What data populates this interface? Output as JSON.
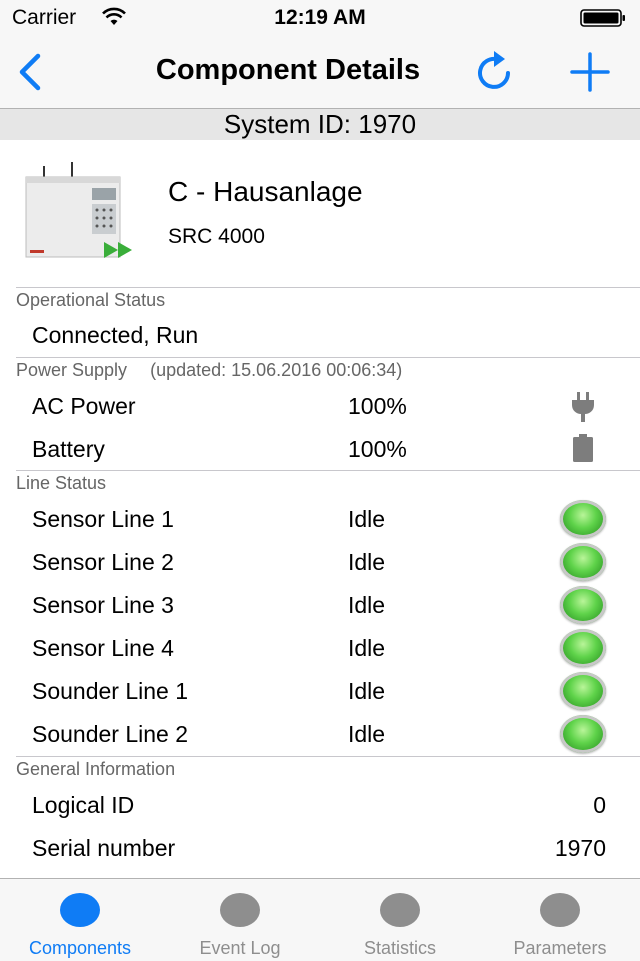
{
  "status_bar": {
    "carrier": "Carrier",
    "time": "12:19 AM"
  },
  "nav": {
    "title": "Component Details",
    "back_icon": "chevron-left-icon",
    "refresh_icon": "refresh-icon",
    "add_icon": "plus-icon"
  },
  "system": {
    "id_text": "System ID: 1970"
  },
  "component": {
    "name": "C -  Hausanlage",
    "model": "SRC 4000"
  },
  "operational": {
    "header": "Operational Status",
    "value": "Connected, Run"
  },
  "power": {
    "header": "Power Supply",
    "updated": "(updated: 15.06.2016 00:06:34)",
    "rows": [
      {
        "label": "AC Power",
        "value": "100%",
        "icon": "plug-icon"
      },
      {
        "label": "Battery",
        "value": "100%",
        "icon": "battery-icon"
      }
    ]
  },
  "lines": {
    "header": "Line Status",
    "rows": [
      {
        "label": "Sensor Line 1",
        "value": "Idle",
        "status_color": "#5fd34a"
      },
      {
        "label": "Sensor Line 2",
        "value": "Idle",
        "status_color": "#5fd34a"
      },
      {
        "label": "Sensor Line 3",
        "value": "Idle",
        "status_color": "#5fd34a"
      },
      {
        "label": "Sensor Line 4",
        "value": "Idle",
        "status_color": "#5fd34a"
      },
      {
        "label": "Sounder Line 1",
        "value": "Idle",
        "status_color": "#5fd34a"
      },
      {
        "label": "Sounder Line 2",
        "value": "Idle",
        "status_color": "#5fd34a"
      }
    ]
  },
  "general": {
    "header": "General Information",
    "rows": [
      {
        "label": "Logical ID",
        "value": "0"
      },
      {
        "label": "Serial number",
        "value": "1970"
      }
    ]
  },
  "tabs": [
    {
      "label": "Components",
      "active": true
    },
    {
      "label": "Event Log",
      "active": false
    },
    {
      "label": "Statistics",
      "active": false
    },
    {
      "label": "Parameters",
      "active": false
    }
  ],
  "colors": {
    "accent": "#0f7cf5",
    "inactive": "#8e8e8e",
    "led_green": "#5fd34a"
  }
}
